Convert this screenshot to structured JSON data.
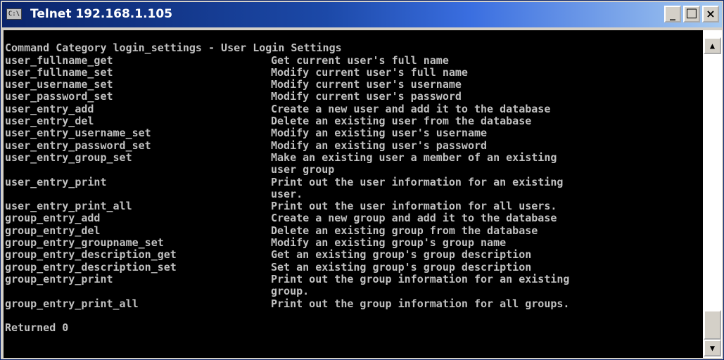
{
  "window": {
    "title": "Telnet 192.168.1.105",
    "icon_text": "C:\\",
    "buttons": {
      "minimize": "_",
      "maximize": "□",
      "close": "×"
    }
  },
  "console": {
    "header": "Command Category login_settings - User Login Settings",
    "rows": [
      {
        "cmd": "user_fullname_get",
        "desc": "Get current user's full name"
      },
      {
        "cmd": "user_fullname_set",
        "desc": "Modify current user's full name"
      },
      {
        "cmd": "user_username_set",
        "desc": "Modify current user's username"
      },
      {
        "cmd": "user_password_set",
        "desc": "Modify current user's password"
      },
      {
        "cmd": "user_entry_add",
        "desc": "Create a new user and add it to the database"
      },
      {
        "cmd": "user_entry_del",
        "desc": "Delete an existing user from the database"
      },
      {
        "cmd": "user_entry_username_set",
        "desc": "Modify an existing user's username"
      },
      {
        "cmd": "user_entry_password_set",
        "desc": "Modify an existing user's password"
      },
      {
        "cmd": "user_entry_group_set",
        "desc": "Make an existing user a member of an existing"
      },
      {
        "cmd": "",
        "desc": "user group"
      },
      {
        "cmd": "user_entry_print",
        "desc": "Print out the user information for an existing"
      },
      {
        "cmd": "",
        "desc": "user."
      },
      {
        "cmd": "user_entry_print_all",
        "desc": "Print out the user information for all users."
      },
      {
        "cmd": "group_entry_add",
        "desc": "Create a new group and add it to the database"
      },
      {
        "cmd": "group_entry_del",
        "desc": "Delete an existing group from the database"
      },
      {
        "cmd": "group_entry_groupname_set",
        "desc": "Modify an existing group's group name"
      },
      {
        "cmd": "group_entry_description_get",
        "desc": "Get an existing group's group description"
      },
      {
        "cmd": "group_entry_description_set",
        "desc": "Set an existing group's group description"
      },
      {
        "cmd": "group_entry_print",
        "desc": "Print out the group information for an existing"
      },
      {
        "cmd": "",
        "desc": "group."
      },
      {
        "cmd": "group_entry_print_all",
        "desc": "Print out the group information for all groups."
      }
    ],
    "footer": "Returned 0"
  },
  "scrollbar": {
    "up_arrow": "▲",
    "down_arrow": "▼"
  }
}
